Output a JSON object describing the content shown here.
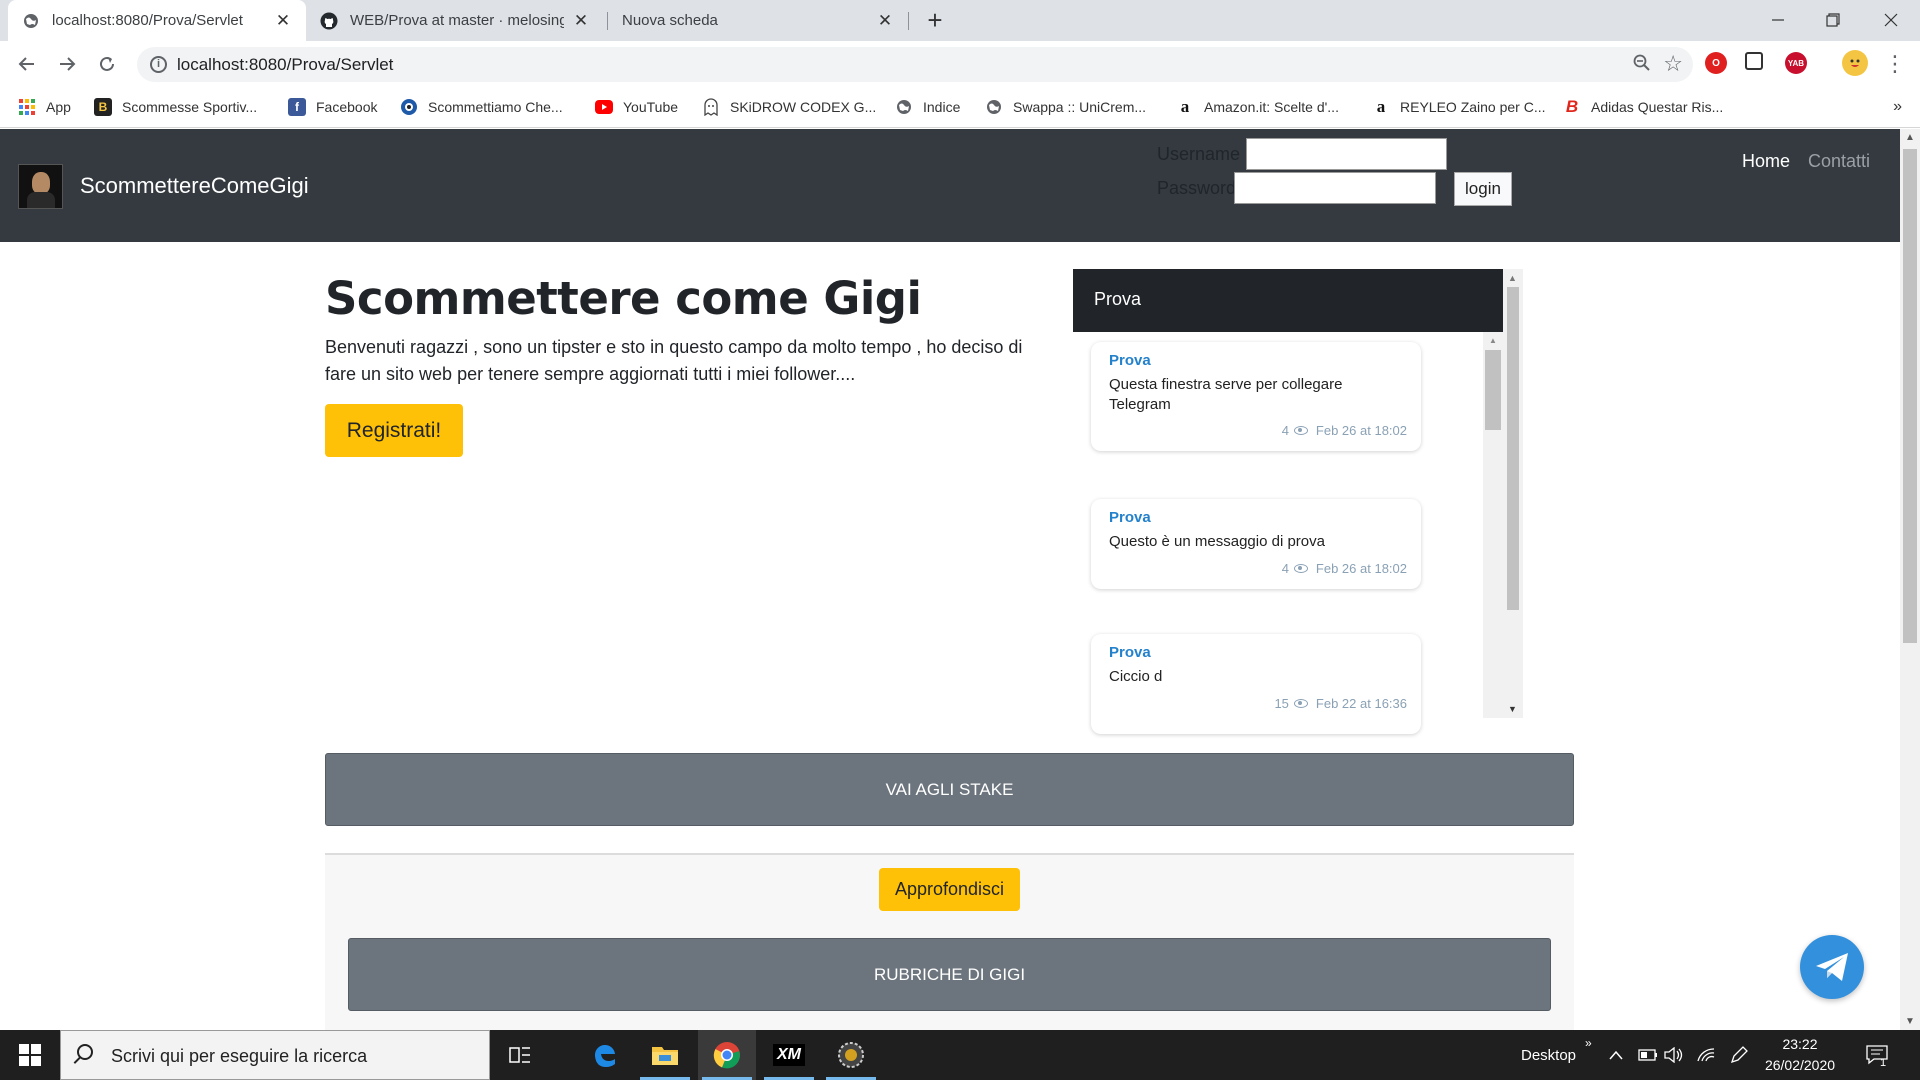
{
  "browser": {
    "tabs": [
      {
        "title": "localhost:8080/Prova/Servlet",
        "active": true
      },
      {
        "title": "WEB/Prova at master · melosingh",
        "active": false
      },
      {
        "title": "Nuova scheda",
        "active": false
      }
    ],
    "new_tab": "+",
    "url": "localhost:8080/Prova/Servlet",
    "window_controls": {
      "minimize": "—",
      "restore": "❐",
      "close": "✕"
    }
  },
  "bookmarks": [
    {
      "label": "App",
      "icon": "apps-grid-icon"
    },
    {
      "label": "Scommesse Sportiv...",
      "icon": "betting-icon"
    },
    {
      "label": "Facebook",
      "icon": "facebook-icon"
    },
    {
      "label": "Scommettiamo Che...",
      "icon": "ball-icon"
    },
    {
      "label": "YouTube",
      "icon": "youtube-icon"
    },
    {
      "label": "SKiDROW CODEX G...",
      "icon": "ghost-icon"
    },
    {
      "label": "Indice",
      "icon": "globe-icon"
    },
    {
      "label": "Swappa :: UniCrem...",
      "icon": "globe-icon"
    },
    {
      "label": "Amazon.it: Scelte d'...",
      "icon": "amazon-icon"
    },
    {
      "label": "REYLEO Zaino per C...",
      "icon": "amazon-icon"
    },
    {
      "label": "Adidas Questar Ris...",
      "icon": "brand-b-icon"
    }
  ],
  "bookmarks_more": "»",
  "site": {
    "brand": "ScommettereComeGigi",
    "login": {
      "username_label": "Username",
      "password_label": "Password",
      "button": "login"
    },
    "nav": {
      "home": "Home",
      "contact": "Contatti"
    },
    "jumbotron": {
      "title": "Scommettere come Gigi",
      "text": "Benvenuti ragazzi , sono un tipster e sto in questo campo da molto tempo , ho deciso di fare un sito web per tenere sempre aggiornati tutti i miei follower....",
      "register": "Registrati!"
    },
    "widget": {
      "title": "Prova",
      "messages": [
        {
          "author": "Prova",
          "text": "Questa finestra serve per collegare Telegram",
          "views": "4",
          "date": "Feb 26 at 18:02"
        },
        {
          "author": "Prova",
          "text": "Questo è un messaggio di prova",
          "views": "4",
          "date": "Feb 26 at 18:02"
        },
        {
          "author": "Prova",
          "text": "Ciccio d",
          "views": "15",
          "date": "Feb 22 at 16:36"
        }
      ]
    },
    "stake_button": "VAI AGLI STAKE",
    "approfondisci_button": "Approfondisci",
    "rubriche_button": "RUBRICHE DI GIGI"
  },
  "taskbar": {
    "search_placeholder": "Scrivi qui per eseguire la ricerca",
    "desktop_label": "Desktop",
    "time": "23:22",
    "date": "26/02/2020",
    "notification_count": "1",
    "apps": [
      "task-view",
      "edge",
      "file-explorer",
      "chrome",
      "xm",
      "game"
    ]
  },
  "colors": {
    "navbar": "#343a40",
    "accent_yellow": "#ffc107",
    "gray_button": "#6c757d",
    "telegram_blue": "#3390dc",
    "telegram_author": "#2481cc"
  }
}
